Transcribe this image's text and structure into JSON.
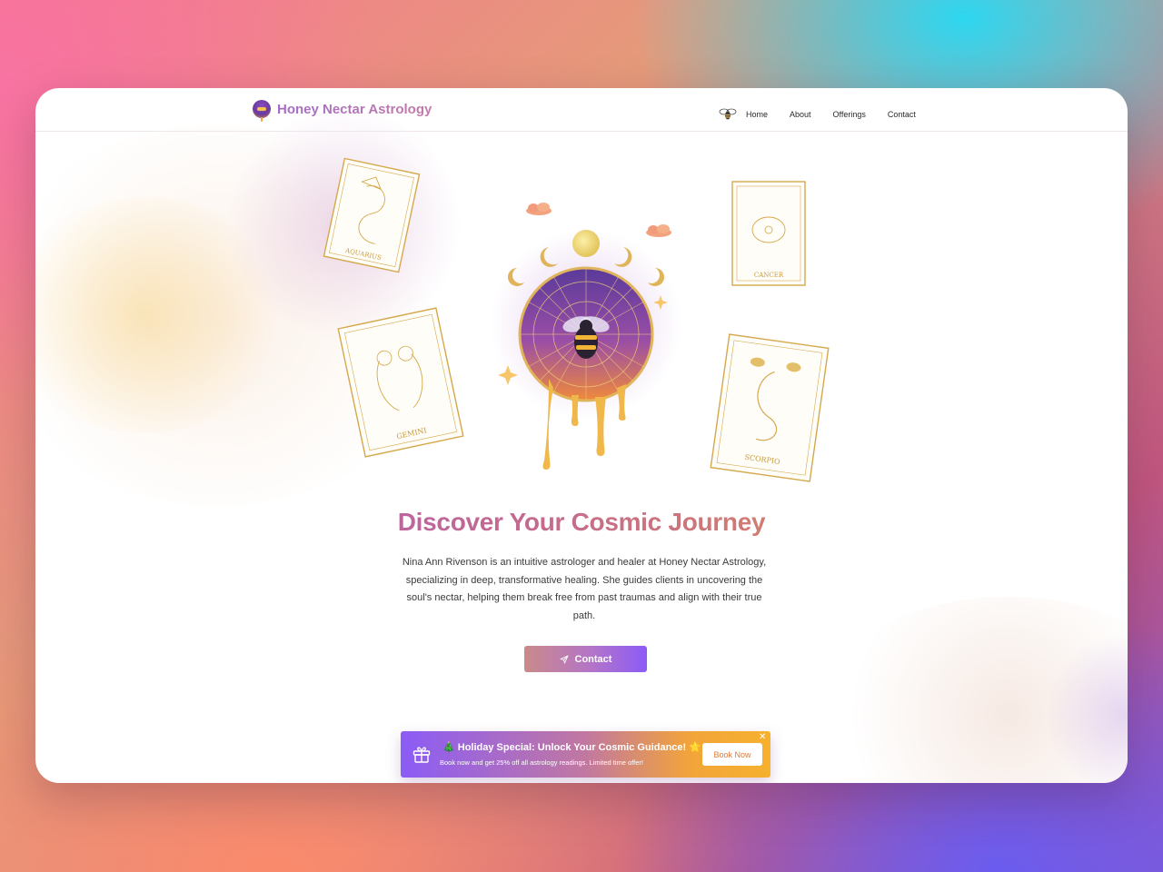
{
  "brand": {
    "name": "Honey Nectar Astrology"
  },
  "nav": {
    "items": [
      "Home",
      "About",
      "Offerings",
      "Contact"
    ]
  },
  "hero": {
    "title": "Discover Your Cosmic Journey",
    "description": "Nina Ann Rivenson is an intuitive astrologer and healer at Honey Nectar Astrology, specializing in deep, transformative healing. She guides clients in uncovering the soul's nectar, helping them break free from past traumas and align with their true path.",
    "cta_label": "Contact",
    "cta_icon": "send-icon"
  },
  "cards": [
    "AQUARIUS",
    "GEMINI",
    "CANCER",
    "SCORPIO"
  ],
  "promo": {
    "title": "🎄 Holiday Special: Unlock Your Cosmic Guidance! 🌟",
    "subtitle": "Book now and get 25% off all astrology readings. Limited time offer!",
    "button_label": "Book Now",
    "close_symbol": "✕",
    "icon": "gift-icon"
  },
  "colors": {
    "accent_purple": "#8b5cf6",
    "accent_gold": "#e0b04a",
    "title_gradient_start": "#a35cc6",
    "title_gradient_end": "#e49a45"
  }
}
